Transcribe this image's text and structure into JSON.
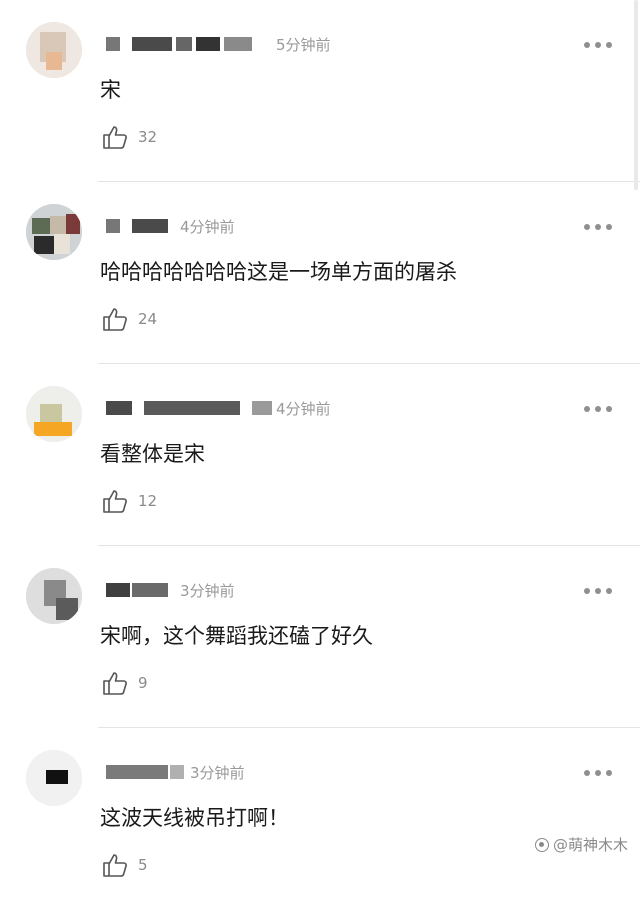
{
  "comments": [
    {
      "time": "5分钟前",
      "text": "宋",
      "likes": "32"
    },
    {
      "time": "4分钟前",
      "text": "哈哈哈哈哈哈哈这是一场单方面的屠杀",
      "likes": "24"
    },
    {
      "time": "4分钟前",
      "text": "看整体是宋",
      "likes": "12"
    },
    {
      "time": "3分钟前",
      "text": "宋啊，这个舞蹈我还磕了好久",
      "likes": "9"
    },
    {
      "time": "3分钟前",
      "text": "这波天线被吊打啊！",
      "likes": "5"
    }
  ],
  "watermark": "@萌神木木",
  "icons": {
    "like": "thumbs-up-icon",
    "more": "more-dots-icon",
    "watermark": "weibo-icon"
  }
}
